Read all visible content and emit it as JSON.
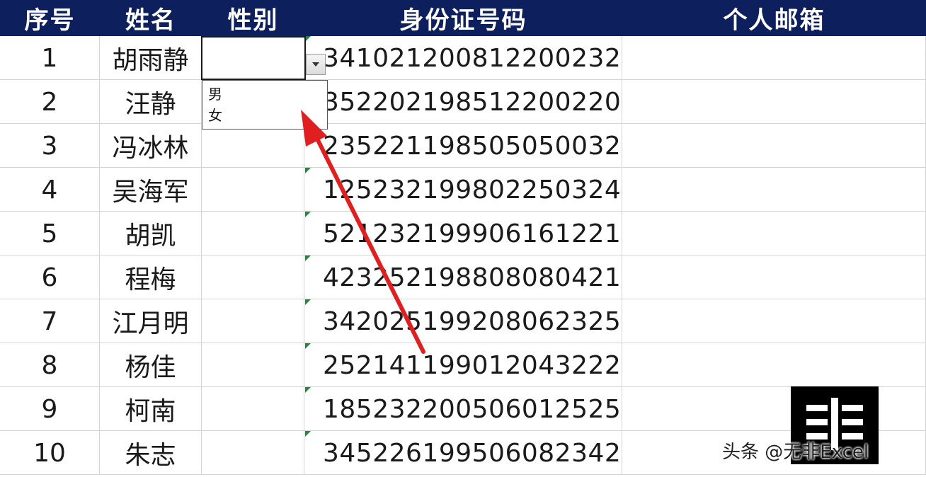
{
  "headers": {
    "seq": "序号",
    "name": "姓名",
    "gender": "性别",
    "id_number": "身份证号码",
    "email": "个人邮箱"
  },
  "rows": [
    {
      "seq": "1",
      "name": "胡雨静",
      "gender": "",
      "id_number": "341021200812200232",
      "email": ""
    },
    {
      "seq": "2",
      "name": "汪静",
      "gender": "",
      "id_number": "352202198512200220",
      "email": ""
    },
    {
      "seq": "3",
      "name": "冯冰林",
      "gender": "",
      "id_number": "235221198505050032",
      "email": ""
    },
    {
      "seq": "4",
      "name": "吴海军",
      "gender": "",
      "id_number": "125232199802250324",
      "email": ""
    },
    {
      "seq": "5",
      "name": "胡凯",
      "gender": "",
      "id_number": "521232199906161221",
      "email": ""
    },
    {
      "seq": "6",
      "name": "程梅",
      "gender": "",
      "id_number": "423252198808080421",
      "email": ""
    },
    {
      "seq": "7",
      "name": "江月明",
      "gender": "",
      "id_number": "342025199208062325",
      "email": ""
    },
    {
      "seq": "8",
      "name": "杨佳",
      "gender": "",
      "id_number": "252141199012043222",
      "email": ""
    },
    {
      "seq": "9",
      "name": "柯南",
      "gender": "",
      "id_number": "185232200506012525",
      "email": ""
    },
    {
      "seq": "10",
      "name": "朱志",
      "gender": "",
      "id_number": "345226199506082342",
      "email": ""
    }
  ],
  "dropdown": {
    "options": [
      "男",
      "女"
    ]
  },
  "watermark": {
    "text": "头条 @无非Excel"
  },
  "colors": {
    "header_bg": "#0d1f5c",
    "header_text": "#ffffff",
    "gridline": "#d4d4d4",
    "arrow": "#e02020",
    "error_indicator": "#1f8a3a"
  }
}
